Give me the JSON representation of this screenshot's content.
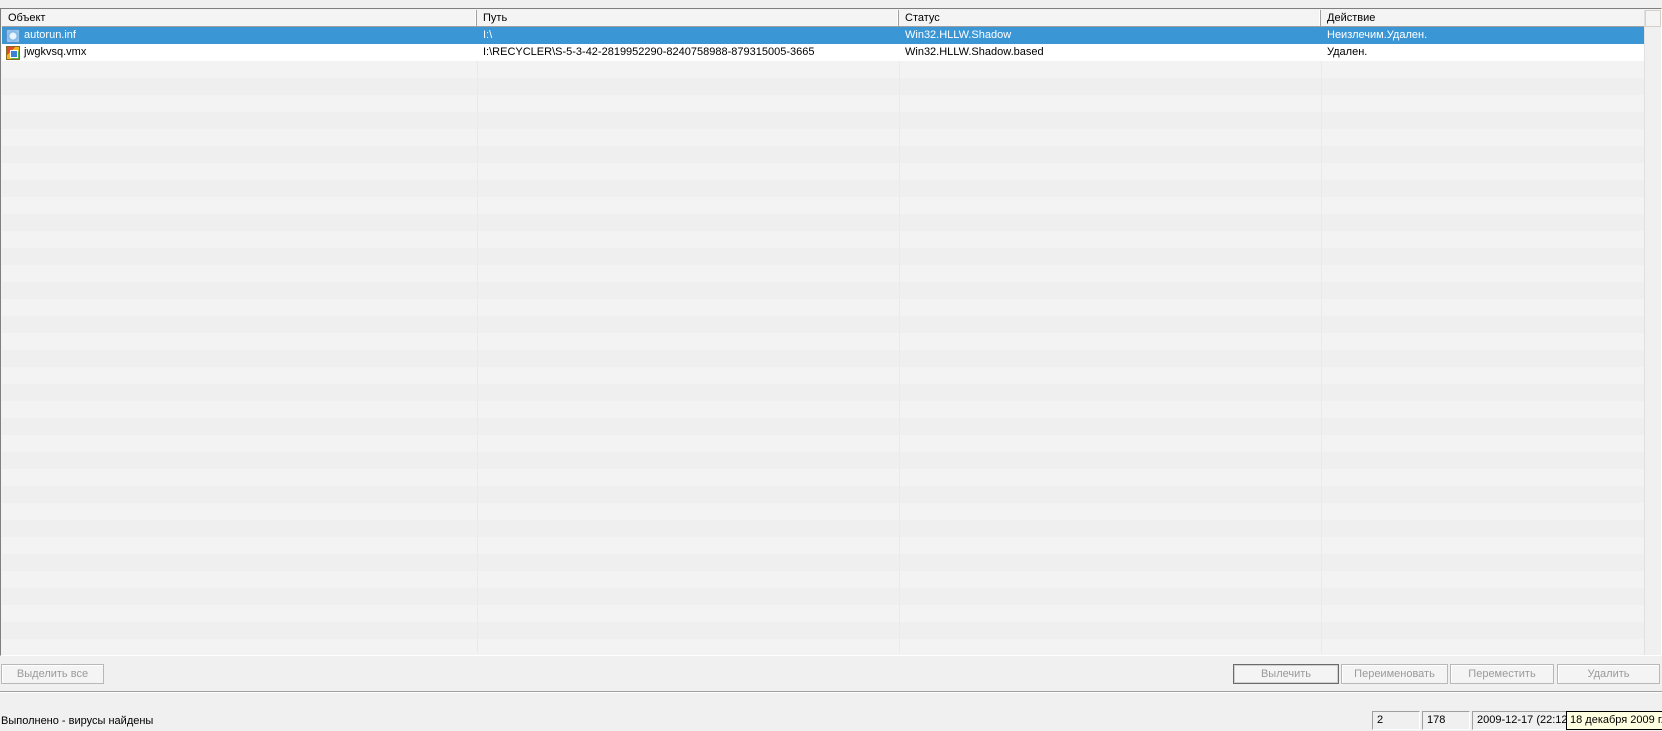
{
  "columns": [
    "Объект",
    "Путь",
    "Статус",
    "Действие"
  ],
  "rows": [
    {
      "icon": "inf-file-icon",
      "object": "autorun.inf",
      "path": "I:\\",
      "status": "Win32.HLLW.Shadow",
      "action": "Неизлечим.Удален.",
      "selected": true
    },
    {
      "icon": "vmx-file-icon",
      "object": "jwgkvsq.vmx",
      "path": "I:\\RECYCLER\\S-5-3-42-2819952290-8240758988-879315005-3665",
      "status": "Win32.HLLW.Shadow.based",
      "action": "Удален.",
      "selected": false
    }
  ],
  "buttons": {
    "select_all": "Выделить все",
    "cure": "Вылечить",
    "rename": "Переименовать",
    "move": "Переместить",
    "delete": "Удалить"
  },
  "status_bar": {
    "message": "Выполнено - вирусы найдены",
    "count1": "2",
    "count2": "178",
    "datetime": "2009-12-17 (22:12",
    "tooltip": "18 декабря 2009 г."
  },
  "colors": {
    "selection": "#3b96d6"
  }
}
